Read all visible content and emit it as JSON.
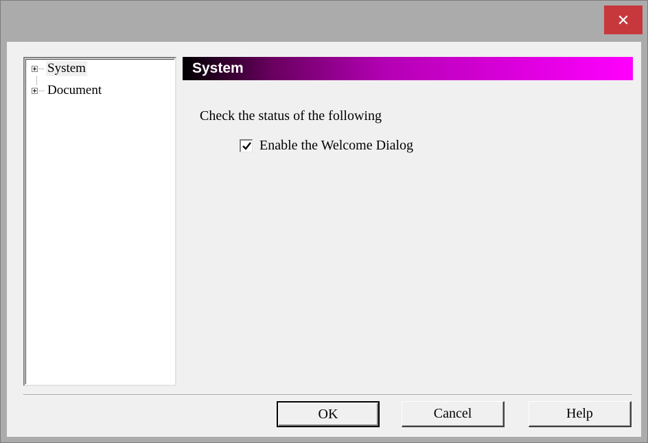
{
  "window": {
    "close_icon": "close-icon",
    "close_glyph": "✕"
  },
  "tree": {
    "items": [
      {
        "label": "System",
        "icon": "expand-plus-icon",
        "selected": true
      },
      {
        "label": "Document",
        "icon": "expand-plus-icon",
        "selected": false
      }
    ]
  },
  "panel": {
    "header_title": "System",
    "header_gradient": [
      "#000000",
      "#ff00ff"
    ],
    "instruction": "Check the status of the following",
    "checkbox": {
      "label": "Enable the Welcome Dialog",
      "checked": true,
      "check_glyph": "✔"
    }
  },
  "buttons": {
    "ok": "OK",
    "cancel": "Cancel",
    "help": "Help"
  },
  "colors": {
    "close_button": "#c7383d",
    "titlebar": "#ababab",
    "dialog_bg": "#f0f0f0"
  }
}
